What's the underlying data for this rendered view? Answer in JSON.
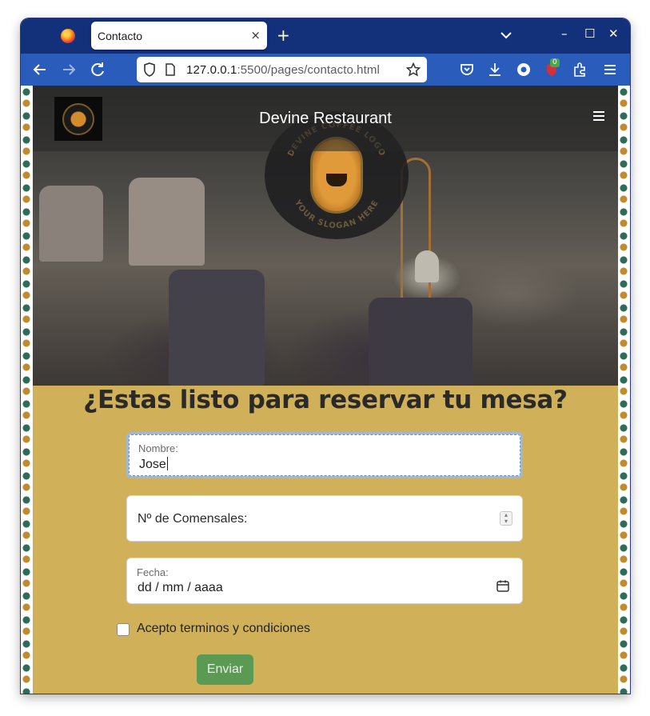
{
  "browser": {
    "tab_title": "Contacto",
    "tab_close": "×",
    "new_tab": "+",
    "url_host": "127.0.0.1",
    "url_path": ":5500/pages/contacto.html",
    "extension_badge": "0",
    "window_controls": {
      "minimize": "–",
      "maximize": "☐",
      "close": "✕"
    }
  },
  "site": {
    "brand_name": "Devine Restaurant",
    "logo_ring_top": "DEVINE COFFEE LOGO",
    "logo_ring_bottom": "YOUR SLOGAN HERE"
  },
  "form": {
    "title": "¿Estas listo para reservar tu mesa?",
    "name_label": "Nombre:",
    "name_value": "Jose",
    "guests_placeholder": "Nº de Comensales:",
    "date_label": "Fecha:",
    "date_value": "dd / mm / aaaa",
    "terms_label": "Acepto terminos y condiciones",
    "terms_checked": false,
    "submit_label": "Enviar"
  },
  "colors": {
    "browser_tabstrip": "#13307a",
    "browser_toolbar": "#2a5cbc",
    "section_bg": "#d0b15a",
    "submit_bg": "#5a9a52"
  }
}
